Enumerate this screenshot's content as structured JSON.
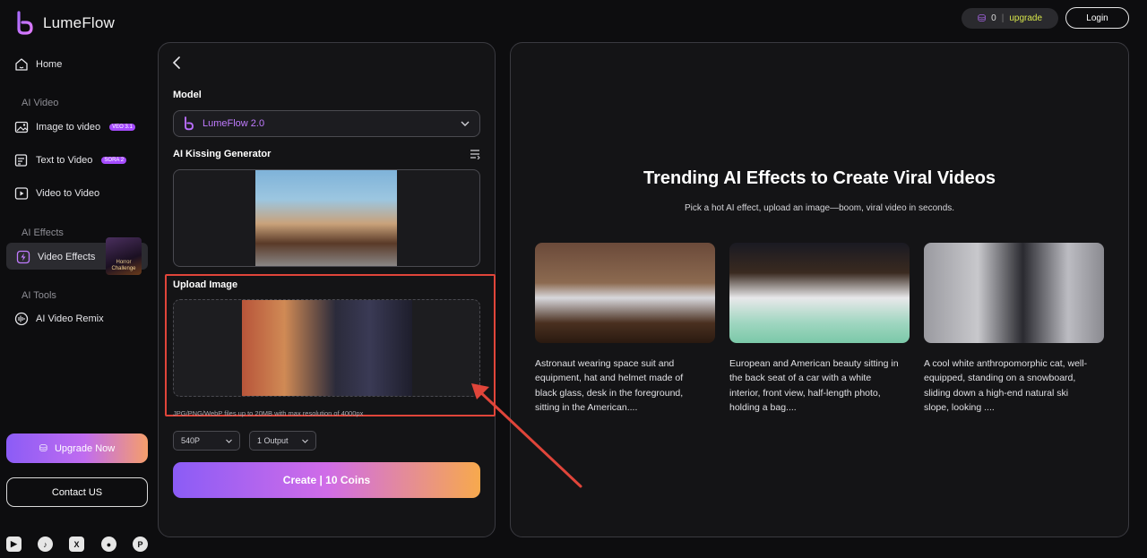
{
  "app": {
    "name": "LumeFlow"
  },
  "header": {
    "coins": "0",
    "separator": "|",
    "upgrade_label": "upgrade",
    "login_label": "Login"
  },
  "sidebar": {
    "home": "Home",
    "section_ai_video": "AI Video",
    "image_to_video": "Image to video",
    "image_to_video_badge": "VEO 3.1",
    "text_to_video": "Text to Video",
    "text_to_video_badge": "SORA 2",
    "video_to_video": "Video to Video",
    "section_ai_effects": "AI Effects",
    "video_effects": "Video Effects",
    "promo_label": "Horror Challenge",
    "section_ai_tools": "AI Tools",
    "ai_video_remix": "AI Video Remix",
    "upgrade_now": "Upgrade Now",
    "contact_us": "Contact US",
    "socials": [
      "youtube-icon",
      "tiktok-icon",
      "x-icon",
      "reddit-icon",
      "producthunt-icon"
    ]
  },
  "form": {
    "model_label": "Model",
    "model_value": "LumeFlow 2.0",
    "generator_label": "AI Kissing Generator",
    "upload_label": "Upload Image",
    "upload_hint": "JPG/PNG/WebP files up to 20MB with max resolution of 4000px",
    "resolution_value": "540P",
    "output_value": "1 Output",
    "create_label": "Create | 10 Coins"
  },
  "trending": {
    "title": "Trending AI Effects to Create Viral Videos",
    "subtitle": "Pick a hot AI effect, upload an image—boom, viral video in seconds.",
    "cards": [
      {
        "text": "Astronaut wearing space suit and equipment, hat and helmet made of black glass, desk in the foreground, sitting in the American...."
      },
      {
        "text": "European and American beauty sitting in the back seat of a car with a white interior, front view, half-length photo, holding a bag...."
      },
      {
        "text": "A cool white anthropomorphic cat, well-equipped, standing on a snowboard, sliding down a high-end natural ski slope, looking ...."
      }
    ]
  },
  "colors": {
    "accent": "#a54bff",
    "highlight": "#e0453a",
    "upgrade_text": "#d7e64b"
  }
}
